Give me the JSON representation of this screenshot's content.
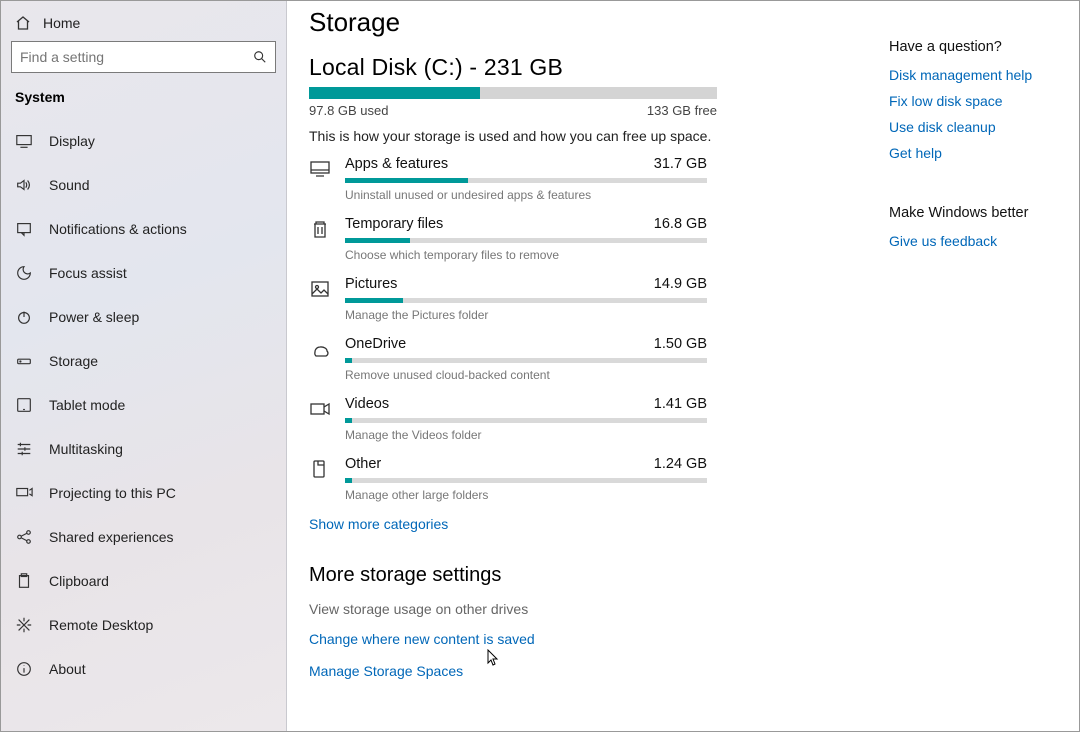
{
  "sidebar": {
    "home": "Home",
    "search_placeholder": "Find a setting",
    "section": "System",
    "items": [
      {
        "label": "Display"
      },
      {
        "label": "Sound"
      },
      {
        "label": "Notifications & actions"
      },
      {
        "label": "Focus assist"
      },
      {
        "label": "Power & sleep"
      },
      {
        "label": "Storage"
      },
      {
        "label": "Tablet mode"
      },
      {
        "label": "Multitasking"
      },
      {
        "label": "Projecting to this PC"
      },
      {
        "label": "Shared experiences"
      },
      {
        "label": "Clipboard"
      },
      {
        "label": "Remote Desktop"
      },
      {
        "label": "About"
      }
    ]
  },
  "page": {
    "title": "Storage",
    "disk_title": "Local Disk (C:) - 231 GB",
    "used_label": "97.8 GB used",
    "free_label": "133 GB free",
    "intro": "This is how your storage is used and how you can free up space.",
    "show_more": "Show more categories",
    "more_heading": "More storage settings",
    "links": {
      "other_drives": "View storage usage on other drives",
      "change_saved": "Change where new content is saved",
      "manage_spaces": "Manage Storage Spaces"
    },
    "categories": [
      {
        "name": "Apps & features",
        "size": "31.7 GB",
        "desc": "Uninstall unused or undesired apps & features",
        "pct": 34
      },
      {
        "name": "Temporary files",
        "size": "16.8 GB",
        "desc": "Choose which temporary files to remove",
        "pct": 18
      },
      {
        "name": "Pictures",
        "size": "14.9 GB",
        "desc": "Manage the Pictures folder",
        "pct": 16
      },
      {
        "name": "OneDrive",
        "size": "1.50 GB",
        "desc": "Remove unused cloud-backed content",
        "pct": 2
      },
      {
        "name": "Videos",
        "size": "1.41 GB",
        "desc": "Manage the Videos folder",
        "pct": 2
      },
      {
        "name": "Other",
        "size": "1.24 GB",
        "desc": "Manage other large folders",
        "pct": 2
      }
    ],
    "disk_used_pct": 42
  },
  "right": {
    "q_head": "Have a question?",
    "q_links": [
      "Disk management help",
      "Fix low disk space",
      "Use disk cleanup",
      "Get help"
    ],
    "better_head": "Make Windows better",
    "better_link": "Give us feedback"
  }
}
